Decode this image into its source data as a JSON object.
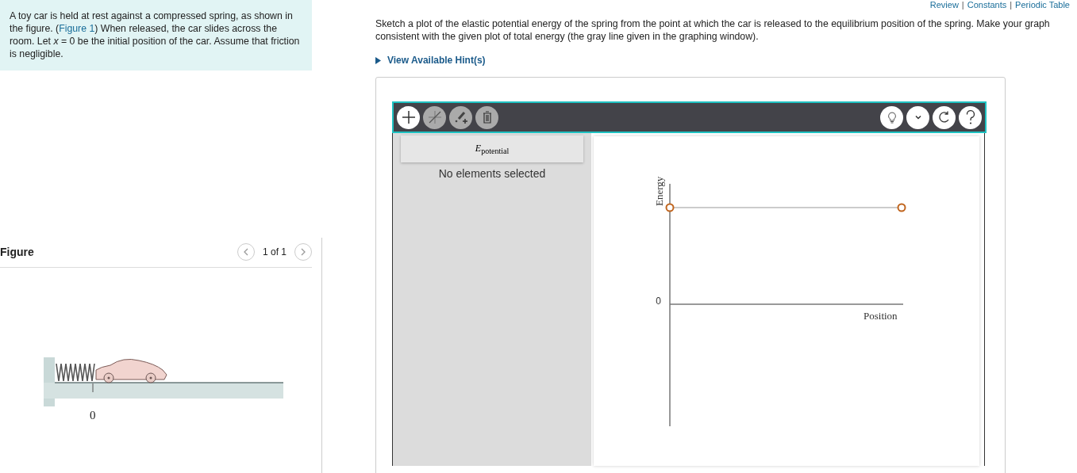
{
  "problem": {
    "before": "A toy car is held at rest against a compressed spring, as shown in the figure. (",
    "link": "Figure 1",
    "after": ") When released, the car slides across the room. Let *x* = 0 be the initial position of the car. Assume that friction is negligible."
  },
  "figure": {
    "title": "Figure",
    "pager": "1 of 1",
    "zero_label": "0"
  },
  "top_links": {
    "items": [
      "Review",
      "Constants",
      "Periodic Table"
    ],
    "separator": "|"
  },
  "instructions": "Sketch a plot of the elastic potential energy of the spring from the point at which the car is released to the equilibrium position of the spring. Make your graph consistent with the given plot of total energy (the gray line given in the graphing window).",
  "hint_link": "View Available Hint(s)",
  "toolbar": {
    "left": [
      {
        "kind": "point",
        "selected": true
      },
      {
        "kind": "line",
        "selected": false
      },
      {
        "kind": "label",
        "selected": false
      },
      {
        "kind": "delete",
        "selected": false
      }
    ],
    "right": [
      {
        "kind": "hint"
      },
      {
        "kind": "more"
      },
      {
        "kind": "reset"
      },
      {
        "kind": "help"
      }
    ]
  },
  "elements": {
    "items": [
      "*E*$_{potential}$"
    ],
    "status": "No elements selected"
  },
  "graph": {
    "ylabel": "Energy",
    "xlabel": "Position",
    "zero": "0"
  }
}
